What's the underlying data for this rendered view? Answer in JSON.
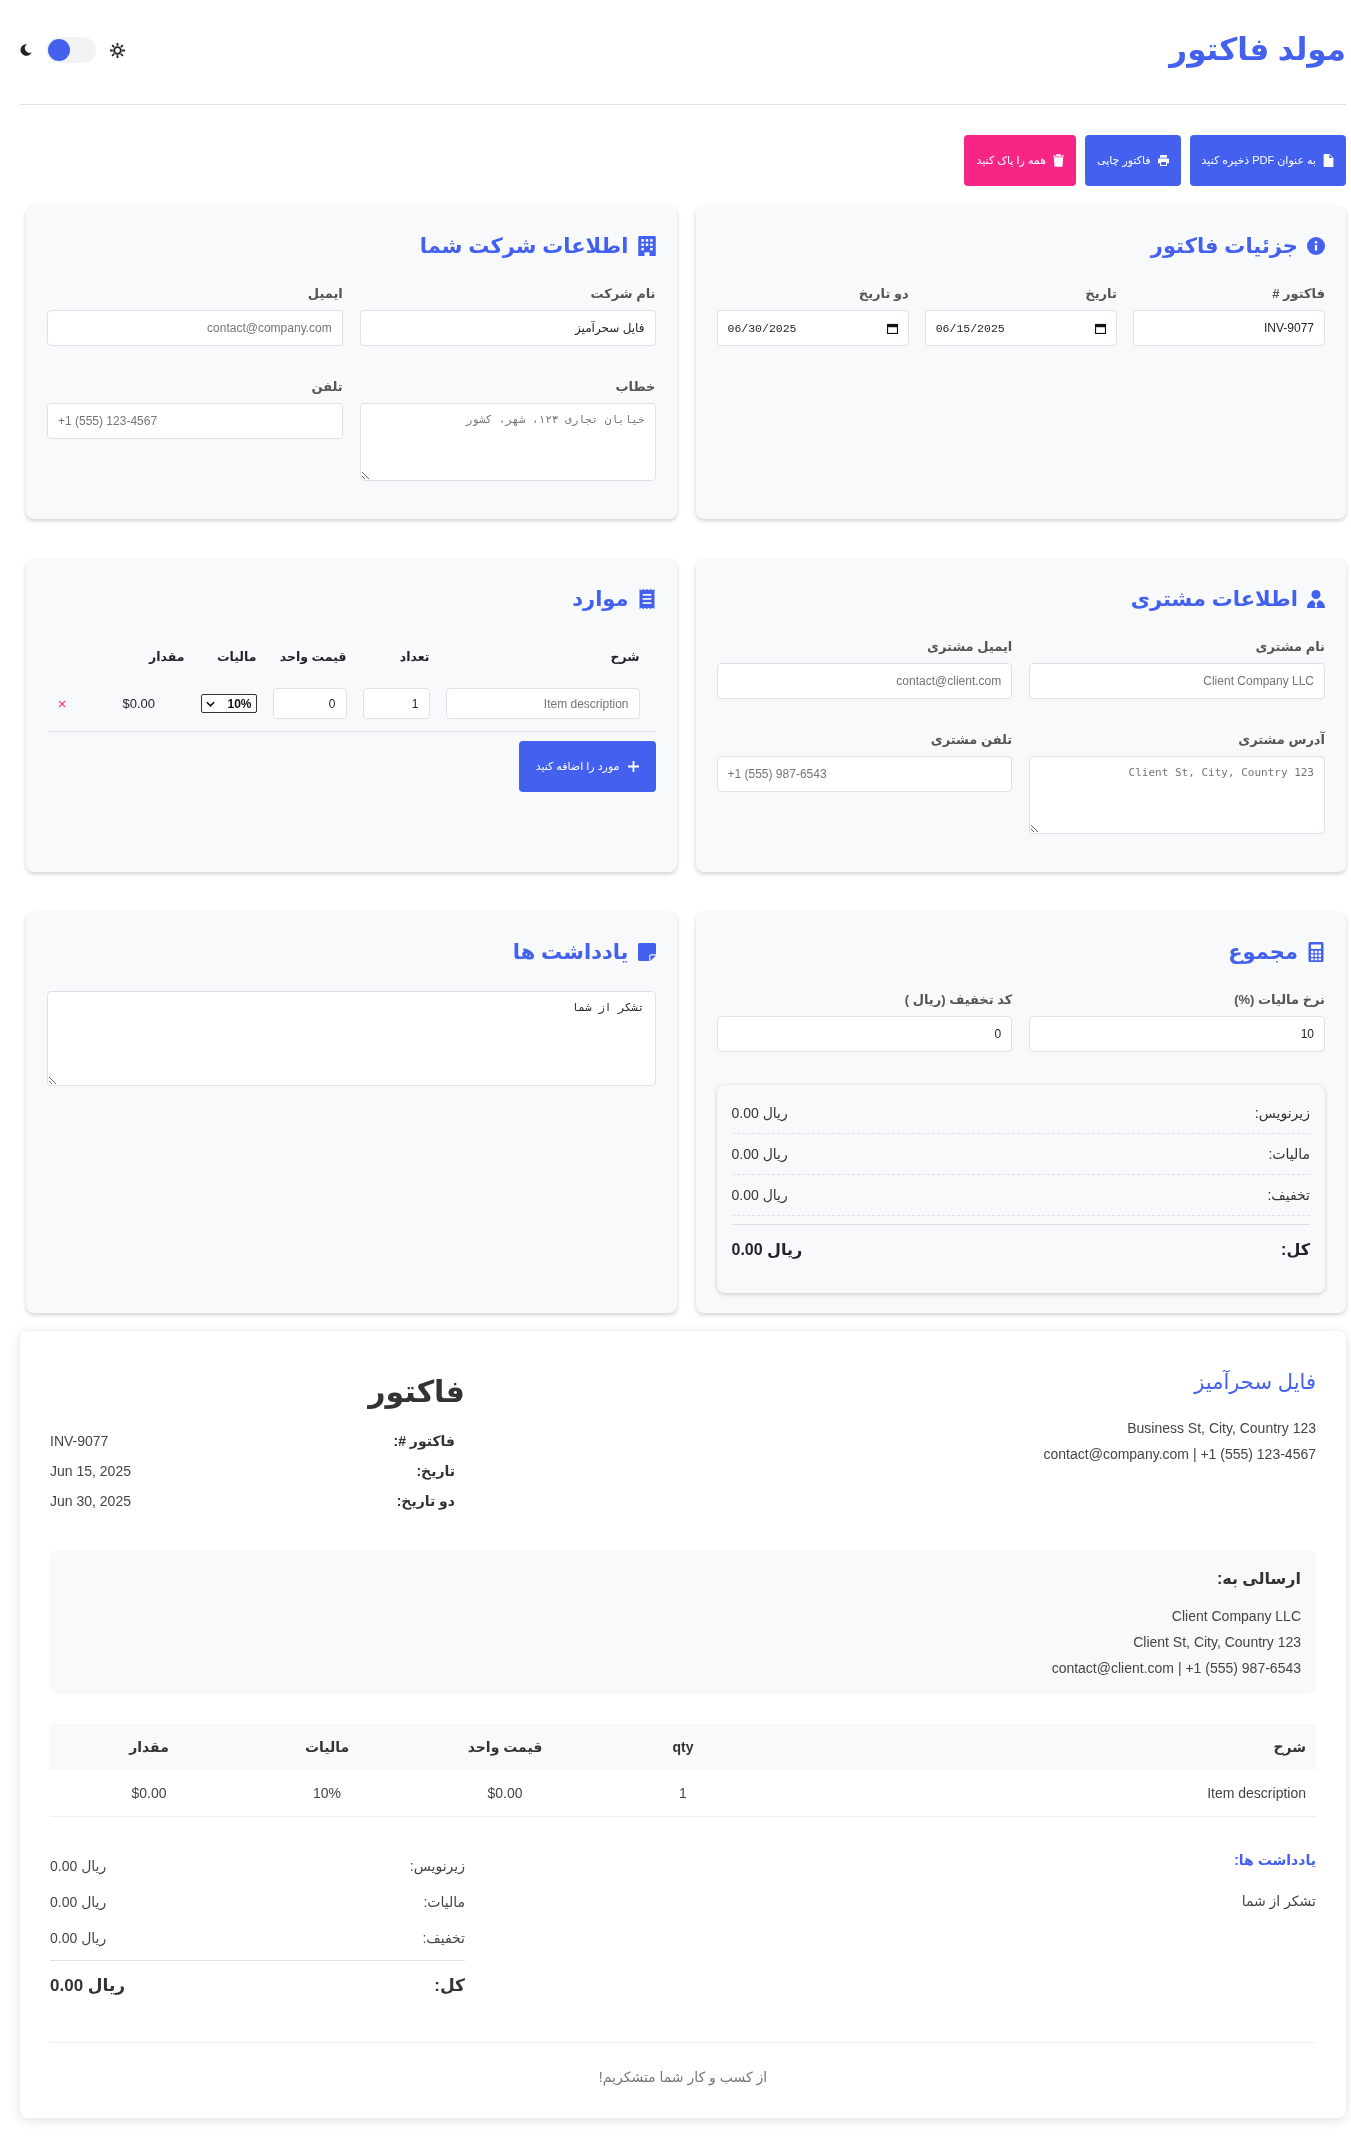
{
  "header": {
    "title": "مولد فاکتور",
    "theme_toggle": {
      "on": false
    }
  },
  "actions": [
    {
      "kind": "pdf",
      "label": "به عنوان PDF ذخیره کنید"
    },
    {
      "kind": "print",
      "label": "فاکتور چاپی"
    },
    {
      "kind": "clear",
      "label": "همه را پاک کنید"
    }
  ],
  "invoice_details": {
    "title": "جزئیات فاکتور",
    "fields": [
      {
        "kind": "text",
        "label": "فاکتور #",
        "value": "INV-9077"
      },
      {
        "kind": "date",
        "label": "تاریخ",
        "value": "06/15/2025"
      },
      {
        "kind": "date",
        "label": "دو تاریخ",
        "value": "06/30/2025"
      }
    ]
  },
  "company": {
    "title": "اطلاعات شرکت شما",
    "fields": [
      {
        "kind": "text",
        "label": "نام شرکت",
        "value": "فایل سحرآمیز"
      },
      {
        "kind": "text",
        "label": "ایمیل",
        "placeholder": "contact@company.com"
      },
      {
        "kind": "textarea",
        "label": "خطاب",
        "placeholder": "خیابان تجاری ۱۲۳، شهر، کشور"
      },
      {
        "kind": "phone",
        "label": "تلفن",
        "placeholder": "+1 (555) 123-4567"
      }
    ]
  },
  "client": {
    "title": "اطلاعات مشتری",
    "fields": [
      {
        "kind": "text",
        "label": "نام مشتری",
        "placeholder": "Client Company LLC"
      },
      {
        "kind": "text",
        "label": "ایمیل مشتری",
        "placeholder": "contact@client.com"
      },
      {
        "kind": "textarea",
        "label": "آدرس مشتری",
        "placeholder": "Client St, City, Country 123"
      },
      {
        "kind": "phone",
        "label": "تلفن مشتری",
        "placeholder": "+1 (555) 987-6543"
      }
    ]
  },
  "items": {
    "title": "موارد",
    "columns": [
      "شرح",
      "تعداد",
      "قیمت واحد",
      "مالیات",
      "مقدار"
    ],
    "rows": [
      {
        "description": {
          "placeholder": "Item description"
        },
        "quantity": "1",
        "unit_price": "0",
        "tax": "10%",
        "amount": "$0.00",
        "remove": "×"
      }
    ],
    "add_button": "مورد را اضافه کنید"
  },
  "totals": {
    "title": "مجموع",
    "fields": [
      {
        "kind": "text",
        "label": "نرخ مالیات (%)",
        "value": "10"
      },
      {
        "kind": "text",
        "label": "کد تخفیف (ریال )",
        "value": "0"
      }
    ],
    "summary": [
      {
        "kind": "line",
        "label": "زیرنویس:",
        "value": "ریال 0.00"
      },
      {
        "kind": "line",
        "label": "مالیات:",
        "value": "ریال 0.00"
      },
      {
        "kind": "line",
        "label": "تخفیف:",
        "value": "ریال 0.00"
      },
      {
        "kind": "total",
        "label": "کل:",
        "value": "ریال 0.00"
      }
    ]
  },
  "notes": {
    "title": "یادداشت ها",
    "value": "تشکر از شما"
  },
  "preview": {
    "company_name": "فایل سحرآمیز",
    "company_lines": [
      "Business St, City, Country 123",
      "contact@company.com | +1 (555) 123-4567"
    ],
    "title": "فاکتور",
    "meta": [
      {
        "label": "فاکتور #:",
        "value": "INV-9077"
      },
      {
        "label": "تاریخ:",
        "value": "Jun 15, 2025"
      },
      {
        "label": "دو تاریخ:",
        "value": "Jun 30, 2025"
      }
    ],
    "bill_to": {
      "title": "ارسالی به:",
      "lines": [
        "Client Company LLC",
        "Client St, City, Country 123",
        "contact@client.com | +1 (555) 987-6543"
      ]
    },
    "table": {
      "columns": [
        "شرح",
        "qty",
        "قیمت واحد",
        "مالیات",
        "مقدار"
      ],
      "rows": [
        [
          "Item description",
          "1",
          "$0.00",
          "10%",
          "$0.00"
        ]
      ]
    },
    "notes": {
      "title": "یادداشت ها:",
      "text": "تشکر از شما"
    },
    "totals": [
      {
        "kind": "line",
        "label": "زیرنویس:",
        "value": "ریال 0.00"
      },
      {
        "kind": "line",
        "label": "مالیات:",
        "value": "ریال 0.00"
      },
      {
        "kind": "line",
        "label": "تخفیف:",
        "value": "ریال 0.00"
      },
      {
        "kind": "total",
        "label": "کل:",
        "value": "ریال 0.00"
      }
    ],
    "footer": "از کسب و کار شما متشکریم!"
  }
}
